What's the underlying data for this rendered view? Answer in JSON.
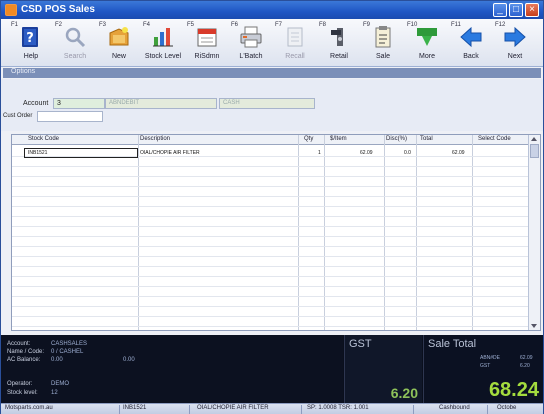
{
  "window": {
    "title": "CSD POS Sales"
  },
  "toolbar": [
    {
      "label": "Help",
      "num": "F1",
      "icon": "help-icon",
      "disabled": false
    },
    {
      "label": "Search",
      "num": "F2",
      "icon": "search-icon",
      "disabled": true
    },
    {
      "label": "New",
      "num": "F3",
      "icon": "new-icon",
      "disabled": false
    },
    {
      "label": "Stock Level",
      "num": "F4",
      "icon": "stock-level-icon",
      "disabled": false
    },
    {
      "label": "RiSdmn",
      "num": "F5",
      "icon": "calendar-icon",
      "disabled": false
    },
    {
      "label": "L'Batch",
      "num": "F6",
      "icon": "printer-icon",
      "disabled": false
    },
    {
      "label": "Recall",
      "num": "F7",
      "icon": "document-icon",
      "disabled": true
    },
    {
      "label": "Retail",
      "num": "F8",
      "icon": "retail-icon",
      "disabled": false
    },
    {
      "label": "Sale",
      "num": "F9",
      "icon": "sale-icon",
      "disabled": false
    },
    {
      "label": "More",
      "num": "F10",
      "icon": "more-icon",
      "disabled": false
    },
    {
      "label": "Back",
      "num": "F11",
      "icon": "back-arrow-icon",
      "disabled": false
    },
    {
      "label": "Next",
      "num": "F12",
      "icon": "next-arrow-icon",
      "disabled": false
    }
  ],
  "section": {
    "title": "Options"
  },
  "account": {
    "label": "Account",
    "value": "3",
    "field2": "ABNDEBIT",
    "field3": "CASH",
    "cust_order_label": "Cust Order"
  },
  "grid": {
    "columns": [
      "Stock Code",
      "Description",
      "Qty",
      "$/Item",
      "Disc(%)",
      "Total",
      "Select Code"
    ],
    "rows": [
      [
        "INB1521",
        "OIAL/CHOPIE AIR FILTER",
        "1",
        "62.09",
        "0.0",
        "62.09",
        ""
      ]
    ]
  },
  "info": {
    "account_label": "Account:",
    "account_value": "CASHSALES",
    "name_label": "Name / Code:",
    "name_value": "0 / CASHEL",
    "balance_label": "AC Balance:",
    "balance_value": "0.00",
    "extra_value": "0.00",
    "operator_label": "Operator:",
    "operator_value": "DEMO",
    "stock_label": "Stock level:",
    "stock_value": "12",
    "gst_label": "GST",
    "gst_value": "6.20",
    "sale_label": "Sale Total",
    "sale_sub1": "ABN#DE",
    "sale_sub2": "GST",
    "sale_sub3": "62.09",
    "sale_sub4": "6.20",
    "sale_value": "68.24"
  },
  "status": [
    "Motsparts.com.au",
    "INB1521",
    "OIAL/CHOPIE AIR FILTER",
    "SP: 1.0008 TSR: 1.001",
    "Cashbound",
    "Octobe"
  ],
  "colors": {
    "accent": "#1f56c4",
    "total": "#a4dc3e",
    "panel": "#0a0f1d"
  }
}
